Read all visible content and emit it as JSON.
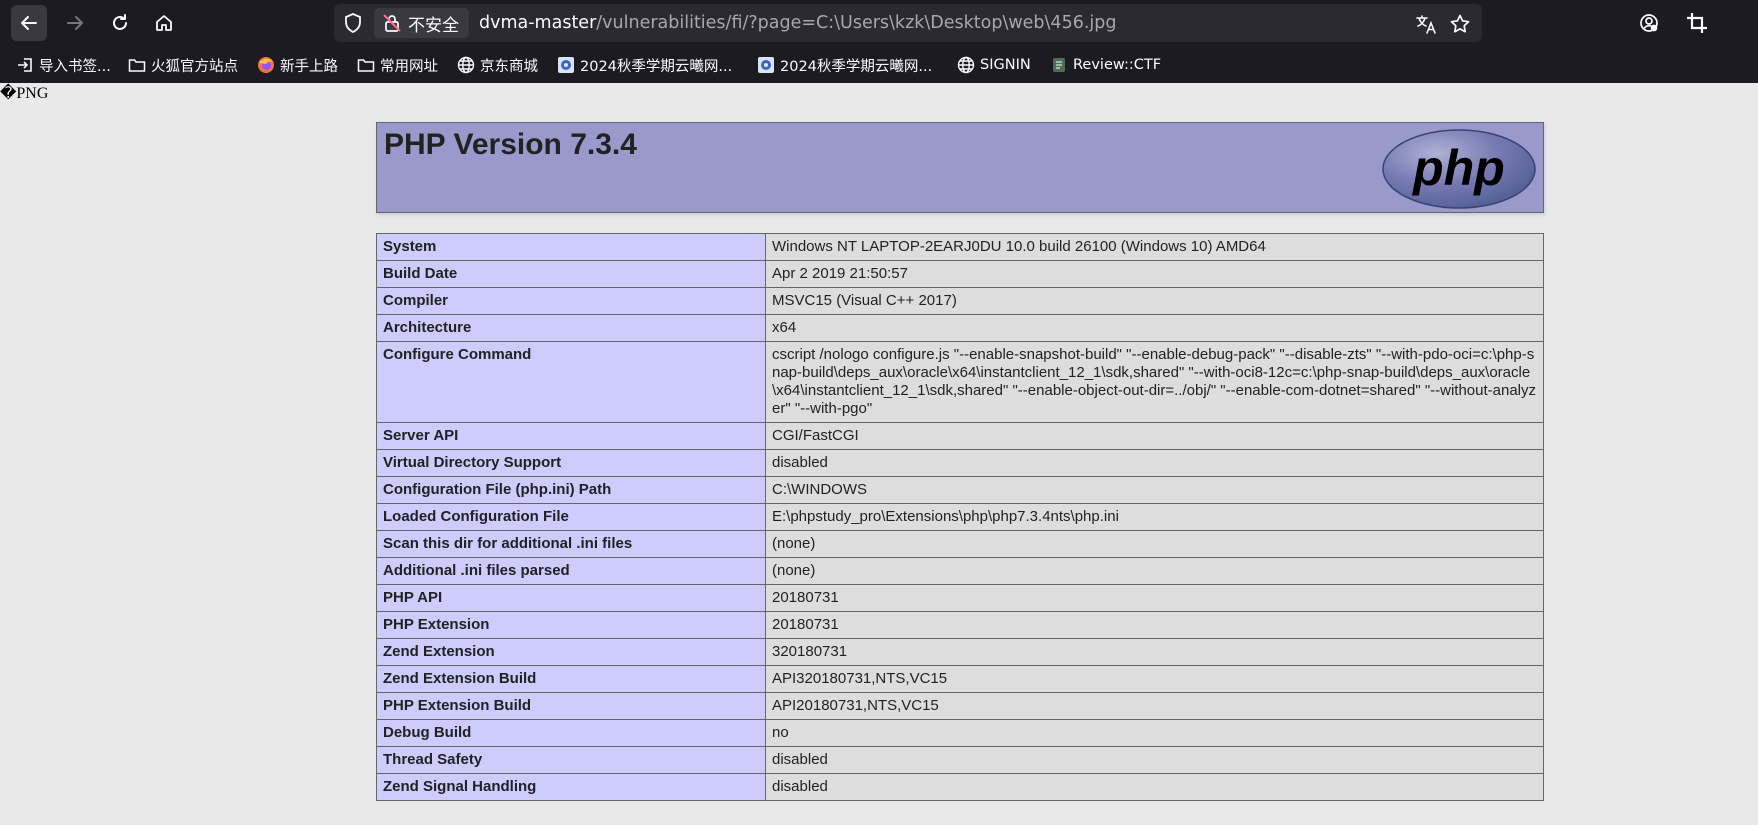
{
  "browser": {
    "url_host": "dvma-master",
    "url_path": "/vulnerabilities/fi/?page=C:\\Users\\kzk\\Desktop\\web\\456.jpg",
    "insecure_label": "不安全",
    "icons": [
      "back-icon",
      "forward-icon",
      "reload-icon",
      "home-icon",
      "shield-icon",
      "insecure-lock-icon",
      "translate-icon",
      "bookmark-star-icon",
      "account-icon",
      "crop-icon"
    ]
  },
  "bookmarks": [
    {
      "label": "导入书签...",
      "icon": "import-icon"
    },
    {
      "label": "火狐官方站点",
      "icon": "folder-icon"
    },
    {
      "label": "新手上路",
      "icon": "firefox-icon"
    },
    {
      "label": "常用网址",
      "icon": "folder-icon"
    },
    {
      "label": "京东商城",
      "icon": "globe-icon"
    },
    {
      "label": "2024秋季学期云曦网...",
      "icon": "site-icon"
    },
    {
      "label": "2024秋季学期云曦网...",
      "icon": "site-icon"
    },
    {
      "label": "SIGNIN",
      "icon": "globe-icon"
    },
    {
      "label": "Review::CTF",
      "icon": "ctf-icon"
    }
  ],
  "page": {
    "raw_prefix": "�PNG",
    "php_version_title": "PHP Version 7.3.4",
    "logo_text": "php",
    "rows": [
      {
        "key": "System",
        "value": "Windows NT LAPTOP-2EARJ0DU 10.0 build 26100 (Windows 10) AMD64"
      },
      {
        "key": "Build Date",
        "value": "Apr 2 2019 21:50:57"
      },
      {
        "key": "Compiler",
        "value": "MSVC15 (Visual C++ 2017)"
      },
      {
        "key": "Architecture",
        "value": "x64"
      },
      {
        "key": "Configure Command",
        "value": "cscript /nologo configure.js \"--enable-snapshot-build\" \"--enable-debug-pack\" \"--disable-zts\" \"--with-pdo-oci=c:\\php-snap-build\\deps_aux\\oracle\\x64\\instantclient_12_1\\sdk,shared\" \"--with-oci8-12c=c:\\php-snap-build\\deps_aux\\oracle\\x64\\instantclient_12_1\\sdk,shared\" \"--enable-object-out-dir=../obj/\" \"--enable-com-dotnet=shared\" \"--without-analyzer\" \"--with-pgo\""
      },
      {
        "key": "Server API",
        "value": "CGI/FastCGI"
      },
      {
        "key": "Virtual Directory Support",
        "value": "disabled"
      },
      {
        "key": "Configuration File (php.ini) Path",
        "value": "C:\\WINDOWS"
      },
      {
        "key": "Loaded Configuration File",
        "value": "E:\\phpstudy_pro\\Extensions\\php\\php7.3.4nts\\php.ini"
      },
      {
        "key": "Scan this dir for additional .ini files",
        "value": "(none)"
      },
      {
        "key": "Additional .ini files parsed",
        "value": "(none)"
      },
      {
        "key": "PHP API",
        "value": "20180731"
      },
      {
        "key": "PHP Extension",
        "value": "20180731"
      },
      {
        "key": "Zend Extension",
        "value": "320180731"
      },
      {
        "key": "Zend Extension Build",
        "value": "API320180731,NTS,VC15"
      },
      {
        "key": "PHP Extension Build",
        "value": "API20180731,NTS,VC15"
      },
      {
        "key": "Debug Build",
        "value": "no"
      },
      {
        "key": "Thread Safety",
        "value": "disabled"
      },
      {
        "key": "Zend Signal Handling",
        "value": "disabled"
      }
    ]
  },
  "colors": {
    "chrome_bg": "#1c1b22",
    "urlbar_bg": "#2b2a33",
    "header_bg": "#9999cc",
    "key_cell_bg": "#ccccff",
    "value_cell_bg": "#dddddd"
  }
}
